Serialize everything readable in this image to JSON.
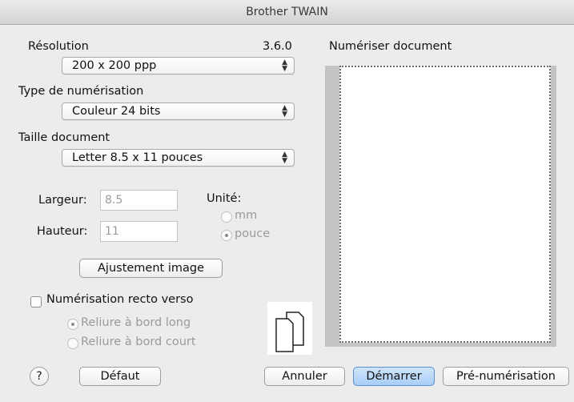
{
  "window": {
    "title": "Brother TWAIN"
  },
  "left": {
    "resolution": {
      "label": "Résolution",
      "version": "3.6.0",
      "value": "200 x 200 ppp"
    },
    "scan_type": {
      "label": "Type de numérisation",
      "value": "Couleur 24 bits"
    },
    "doc_size": {
      "label": "Taille document",
      "value": "Letter  8.5 x 11 pouces"
    },
    "width": {
      "label": "Largeur:",
      "value": "8.5"
    },
    "height": {
      "label": "Hauteur:",
      "value": "11"
    },
    "unit": {
      "label": "Unité:",
      "options": [
        "mm",
        "pouce"
      ],
      "selected": "pouce"
    },
    "adjust_button": "Ajustement image",
    "duplex": {
      "label": "Numérisation recto verso",
      "checked": false,
      "options": [
        "Reliure à bord long",
        "Reliure à bord court"
      ],
      "selected": "Reliure à bord long"
    }
  },
  "right": {
    "preview_label": "Numériser document"
  },
  "footer": {
    "help_symbol": "?",
    "default_button": "Défaut",
    "cancel_button": "Annuler",
    "start_button": "Démarrer",
    "prescan_button": "Pré-numérisation"
  },
  "icons": {
    "select_arrows": "up-down-chevron-icon",
    "help": "question-mark-icon",
    "duplex": "duplex-pages-icon"
  },
  "colors": {
    "primary_button": "#a9cdf6",
    "preview_background": "#c4c4c4"
  }
}
